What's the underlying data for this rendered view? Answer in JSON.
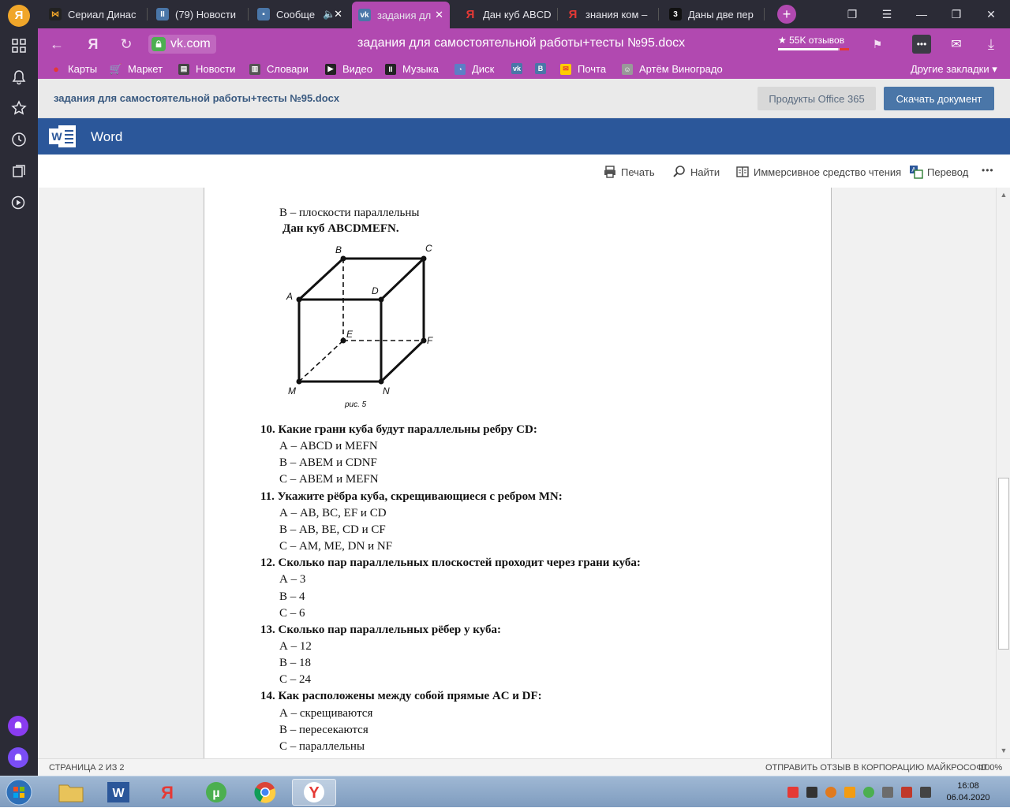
{
  "browser": {
    "tabs": [
      {
        "label": "Сериал Динас",
        "color": "#f0a62a"
      },
      {
        "label": "(79) Новости",
        "color": "#4a76a8"
      },
      {
        "label": "Сообще",
        "color": "#4a76a8"
      },
      {
        "label": "задания дл",
        "color": "#4a76a8"
      },
      {
        "label": "Дан куб ABCD",
        "color": "#e53935"
      },
      {
        "label": "знания ком –",
        "color": "#e53935"
      },
      {
        "label": "Даны две пер",
        "color": "#111111"
      }
    ],
    "url": "vk.com",
    "page_title": "задания для самостоятельной работы+тесты №95.docx",
    "reviews": "★ 55K отзывов",
    "bookmarks": [
      {
        "label": "Карты"
      },
      {
        "label": "Маркет"
      },
      {
        "label": "Новости"
      },
      {
        "label": "Словари"
      },
      {
        "label": "Видео"
      },
      {
        "label": "Музыка"
      },
      {
        "label": "Диск"
      },
      {
        "label": ""
      },
      {
        "label": ""
      },
      {
        "label": "Почта"
      },
      {
        "label": "Артём Виноградо"
      }
    ],
    "other_bookmarks": "Другие закладки ▾"
  },
  "doc_header": {
    "filename": "задания для самостоятельной работы+тесты №95.docx",
    "office_button": "Продукты Office 365",
    "download_button": "Скачать документ"
  },
  "word": {
    "app_name": "Word",
    "toolbar": {
      "print": "Печать",
      "find": "Найти",
      "immersive": "Иммерсивное средство чтения",
      "translate": "Перевод",
      "more": "•••"
    }
  },
  "document": {
    "lines": [
      "В – плоскости параллельны",
      "Дан куб ABCDMEFN.",
      "10. Какие грани куба будут параллельны ребру CD:",
      "А – ABCD и MEFN",
      "В – ABEM и CDNF",
      "С – ABEM и MEFN",
      "11. Укажите рёбра куба, скрещивающиеся с ребром MN:",
      "А –  AB, BC, EF и CD",
      "В – AB, BE, CD и CF",
      "С – AM, ME, DN и NF",
      "12. Сколько пар  параллельных плоскостей проходит через грани куба:",
      "А – 3",
      "В – 4",
      "С – 6",
      "13. Сколько пар  параллельных рёбер у куба:",
      "А – 12",
      "В – 18",
      "С – 24",
      "14. Как расположены между собой прямые AC и DF:",
      "А – скрещиваются",
      "В – пересекаются",
      "С – параллельны"
    ],
    "figure": {
      "labels": {
        "A": "A",
        "B": "B",
        "C": "C",
        "D": "D",
        "E": "E",
        "F": "F",
        "M": "M",
        "N": "N"
      },
      "caption": "рис. 5"
    }
  },
  "status": {
    "page": "СТРАНИЦА 2 ИЗ 2",
    "feedback": "ОТПРАВИТЬ ОТЗЫВ В КОРПОРАЦИЮ МАЙКРОСОФТ",
    "zoom": "100%"
  },
  "taskbar": {
    "time": "16:08",
    "date": "06.04.2020"
  }
}
